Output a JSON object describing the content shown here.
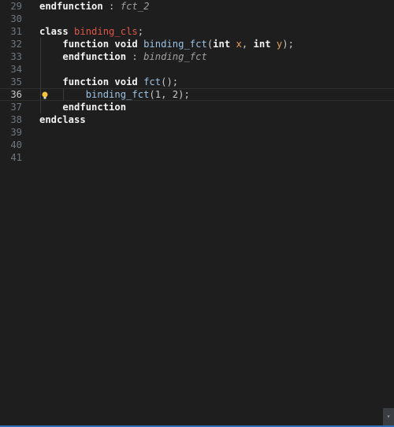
{
  "editor": {
    "lines": [
      {
        "num": "29",
        "tokens": [
          {
            "t": "endfunction",
            "c": "kw"
          },
          {
            "t": " : ",
            "c": "punct"
          },
          {
            "t": "fct_2",
            "c": "comment"
          }
        ]
      },
      {
        "num": "30",
        "tokens": []
      },
      {
        "num": "31",
        "tokens": [
          {
            "t": "class ",
            "c": "kw"
          },
          {
            "t": "binding_cls",
            "c": "cls"
          },
          {
            "t": ";",
            "c": "punct"
          }
        ]
      },
      {
        "num": "32",
        "tokens": [
          {
            "t": "    ",
            "c": "punct"
          },
          {
            "t": "function void ",
            "c": "kw"
          },
          {
            "t": "binding_fct",
            "c": "fn"
          },
          {
            "t": "(",
            "c": "punct"
          },
          {
            "t": "int ",
            "c": "kw"
          },
          {
            "t": "x",
            "c": "param"
          },
          {
            "t": ", ",
            "c": "punct"
          },
          {
            "t": "int ",
            "c": "kw"
          },
          {
            "t": "y",
            "c": "param"
          },
          {
            "t": ");",
            "c": "punct"
          }
        ]
      },
      {
        "num": "33",
        "tokens": [
          {
            "t": "    ",
            "c": "punct"
          },
          {
            "t": "endfunction",
            "c": "kw"
          },
          {
            "t": " : ",
            "c": "punct"
          },
          {
            "t": "binding_fct",
            "c": "comment"
          }
        ]
      },
      {
        "num": "34",
        "tokens": []
      },
      {
        "num": "35",
        "tokens": [
          {
            "t": "    ",
            "c": "punct"
          },
          {
            "t": "function void ",
            "c": "kw"
          },
          {
            "t": "fct",
            "c": "fn"
          },
          {
            "t": "();",
            "c": "punct"
          }
        ]
      },
      {
        "num": "36",
        "current": true,
        "bulb": true,
        "tokens": [
          {
            "t": "        ",
            "c": "punct"
          },
          {
            "t": "binding_fct",
            "c": "fn"
          },
          {
            "t": "(1, 2);",
            "c": "punct"
          }
        ]
      },
      {
        "num": "37",
        "tokens": [
          {
            "t": "    ",
            "c": "punct"
          },
          {
            "t": "endfunction",
            "c": "kw"
          }
        ]
      },
      {
        "num": "38",
        "tokens": [
          {
            "t": "endclass",
            "c": "kw"
          }
        ]
      },
      {
        "num": "39",
        "tokens": []
      },
      {
        "num": "40",
        "tokens": []
      },
      {
        "num": "41",
        "tokens": []
      }
    ]
  },
  "icons": {
    "bulb": "lightbulb-icon",
    "corner": "scroll-corner-icon"
  },
  "colors": {
    "background": "#1e1e1e",
    "keyword": "#f2f2f2",
    "function": "#9cc3e6",
    "class": "#e0574a",
    "param": "#e8a05b",
    "comment": "#a0a0a0",
    "line_number": "#6e7681",
    "bulb": "#f5c242",
    "accent_border": "#2d6fb8"
  },
  "corner_glyph": "▾"
}
